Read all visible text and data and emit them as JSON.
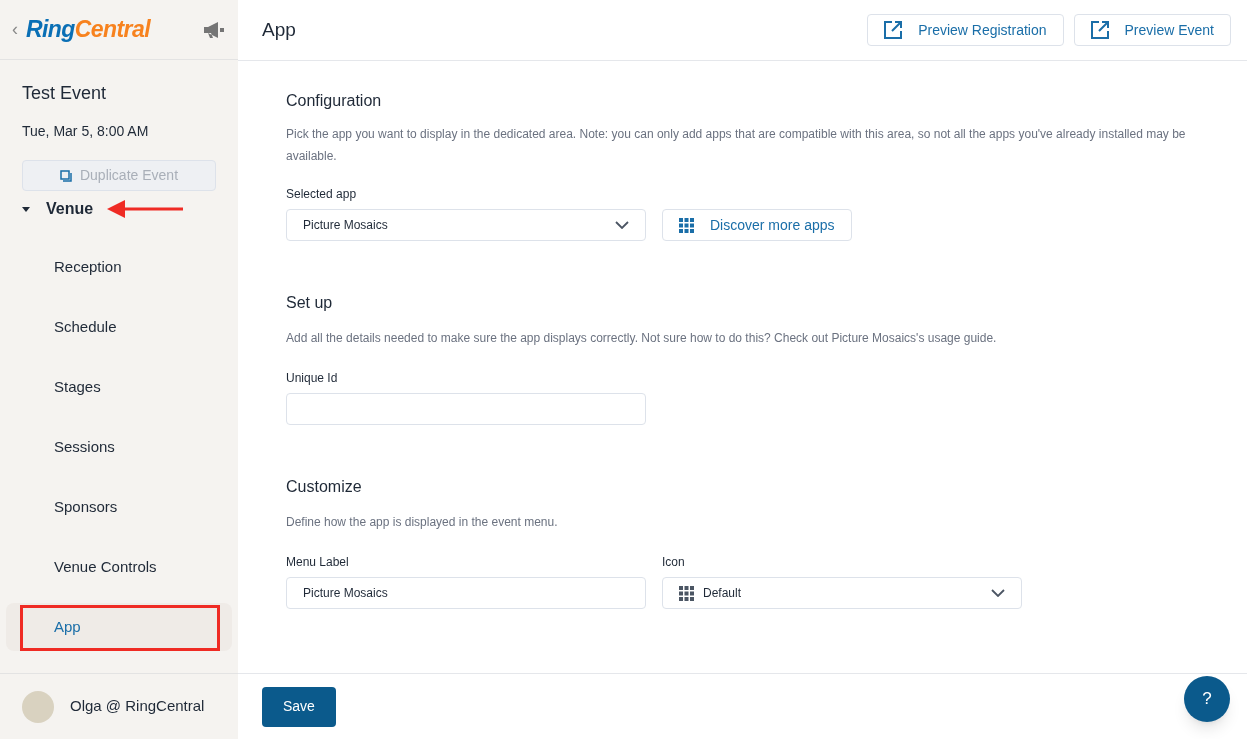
{
  "sidebar": {
    "back": "‹",
    "logo": {
      "first": "Ring",
      "second": "Central"
    },
    "event": {
      "title": "Test Event",
      "date": "Tue, Mar 5, 8:00 AM"
    },
    "duplicate_button": {
      "label": "Duplicate Event",
      "disabled": true
    },
    "section": {
      "label": "Venue",
      "expanded": true,
      "items": [
        {
          "label": "Reception",
          "selected": false
        },
        {
          "label": "Schedule",
          "selected": false
        },
        {
          "label": "Stages",
          "selected": false
        },
        {
          "label": "Sessions",
          "selected": false
        },
        {
          "label": "Sponsors",
          "selected": false
        },
        {
          "label": "Venue Controls",
          "selected": false
        },
        {
          "label": "App",
          "selected": true
        }
      ]
    },
    "user": "Olga @ RingCentral"
  },
  "header": {
    "title": "App",
    "buttons": [
      "Preview Registration",
      "Preview Event"
    ]
  },
  "configuration": {
    "title": "Configuration",
    "description": "Pick the app you want to display in the dedicated area. Note: you can only add apps that are compatible with this area, so not all the apps you've already installed may be available.",
    "label": "Selected app",
    "value": "Picture Mosaics",
    "discover": "Discover more apps"
  },
  "setup": {
    "title": "Set up",
    "description": "Add all the details needed to make sure the app displays correctly. Not sure how to do this? Check out Picture Mosaics's usage guide.",
    "label": "Unique Id"
  },
  "customize": {
    "title": "Customize",
    "description": "Define how the app is displayed in the event menu.",
    "menu_label": {
      "label": "Menu Label",
      "value": "Picture Mosaics"
    },
    "icon": {
      "label": "Icon",
      "value": "Default"
    }
  },
  "footer": {
    "save": "Save",
    "help": "?"
  }
}
